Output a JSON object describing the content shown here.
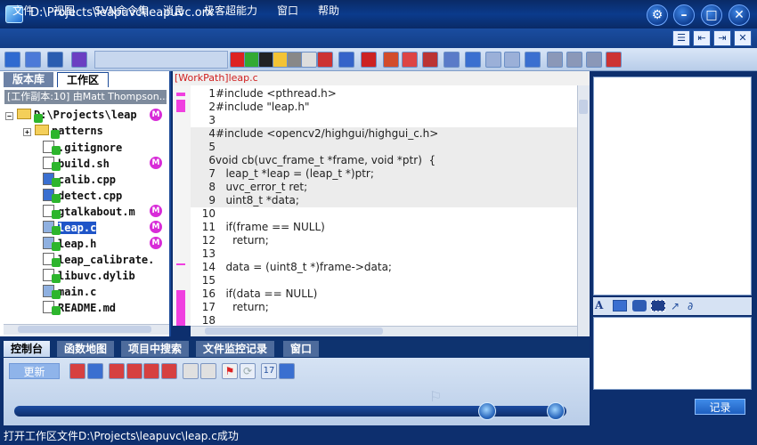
{
  "window": {
    "title": "D:\\Projects\\leapuvc\\leapuvc.orx",
    "buttons": [
      "gear-icon",
      "minimize-icon",
      "maximize-icon",
      "close-icon"
    ]
  },
  "menu": [
    "文件",
    "视图",
    "SVN命令集",
    "消息",
    "极客超能力",
    "窗口",
    "帮助"
  ],
  "left_panel": {
    "tabs": [
      "版本库",
      "工作区"
    ],
    "active_tab": "工作区",
    "info": "[工作副本:10] 由Matt Thompson...",
    "root": "D:\\Projects\\leap",
    "items": [
      {
        "name": "patterns",
        "type": "folder",
        "modified": false
      },
      {
        "name": ".gitignore",
        "type": "file",
        "modified": false
      },
      {
        "name": "build.sh",
        "type": "file",
        "modified": true
      },
      {
        "name": "calib.cpp",
        "type": "file",
        "modified": false
      },
      {
        "name": "detect.cpp",
        "type": "file",
        "modified": false
      },
      {
        "name": "gtalkabout.m",
        "type": "file",
        "modified": true
      },
      {
        "name": "leap.c",
        "type": "file",
        "modified": true,
        "selected": true
      },
      {
        "name": "leap.h",
        "type": "file",
        "modified": true
      },
      {
        "name": "leap_calibrate.",
        "type": "file",
        "modified": false
      },
      {
        "name": "libuvc.dylib",
        "type": "file",
        "modified": false
      },
      {
        "name": "main.c",
        "type": "file",
        "modified": false
      },
      {
        "name": "README.md",
        "type": "file",
        "modified": false
      }
    ],
    "badge": "M"
  },
  "editor": {
    "header": "[WorkPath]leap.c",
    "lines": [
      {
        "n": "1",
        "text": "#include <pthread.h>"
      },
      {
        "n": "2",
        "text": "#include \"leap.h\""
      },
      {
        "n": "3",
        "text": ""
      },
      {
        "n": "4",
        "text": "#include <opencv2/highgui/highgui_c.h>"
      },
      {
        "n": "5",
        "text": ""
      },
      {
        "n": "6",
        "text": "void cb(uvc_frame_t *frame, void *ptr)  {"
      },
      {
        "n": "7",
        "text": "   leap_t *leap = (leap_t *)ptr;"
      },
      {
        "n": "8",
        "text": "   uvc_error_t ret;"
      },
      {
        "n": "9",
        "text": "   uint8_t *data;"
      },
      {
        "n": "10",
        "text": ""
      },
      {
        "n": "11",
        "text": "   if(frame == NULL)"
      },
      {
        "n": "12",
        "text": "     return;"
      },
      {
        "n": "13",
        "text": ""
      },
      {
        "n": "14",
        "text": "   data = (uint8_t *)frame->data;"
      },
      {
        "n": "15",
        "text": ""
      },
      {
        "n": "16",
        "text": "   if(data == NULL)"
      },
      {
        "n": "17",
        "text": "     return;"
      },
      {
        "n": "18",
        "text": ""
      }
    ]
  },
  "bottom_panel": {
    "tabs": [
      "控制台",
      "函数地图",
      "项目中搜索",
      "文件监控记录",
      "窗口"
    ],
    "active_tab": "控制台",
    "update_label": "更新"
  },
  "right_panel": {
    "record_label": "记录"
  },
  "status": "打开工作区文件D:\\Projects\\leapuvc\\leap.c成功",
  "colors": {
    "frame": "#0d2f6e",
    "accent": "#1f55c8",
    "badge": "#d82cd8",
    "check": "#2db52d",
    "diff_marker": "#f040e0"
  }
}
